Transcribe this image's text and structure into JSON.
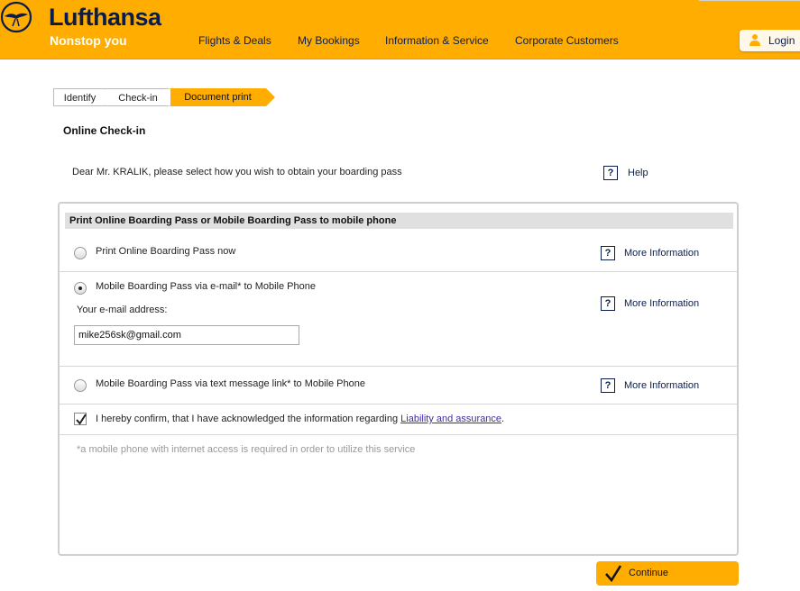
{
  "header": {
    "brand": "Lufthansa",
    "tagline": "Nonstop you",
    "nav": [
      "Flights & Deals",
      "My Bookings",
      "Information & Service",
      "Corporate Customers"
    ],
    "login_label": "Login",
    "login_icon": "user-icon",
    "logo_icon": "crane-logo-icon"
  },
  "breadcrumb": {
    "steps": [
      "Identify",
      "Check-in",
      "Document print"
    ],
    "active_index": 2
  },
  "page": {
    "title": "Online Check-in",
    "greeting": "Dear Mr. KRALIK, please select how you wish to obtain your boarding pass",
    "help_symbol": "?",
    "help_label": "Help"
  },
  "panel": {
    "header": "Print Online Boarding Pass or Mobile Boarding Pass to mobile phone",
    "options": [
      {
        "label": "Print Online Boarding Pass now",
        "selected": false,
        "more_label": "More Information"
      },
      {
        "label": "Mobile Boarding Pass via e-mail* to Mobile Phone",
        "selected": true,
        "more_label": "More Information"
      },
      {
        "label": "Mobile Boarding Pass via text message link* to Mobile Phone",
        "selected": false,
        "more_label": "More Information"
      }
    ],
    "email_label": "Your e-mail address:",
    "email_value": "mike256sk@gmail.com",
    "confirm_prefix": "I hereby confirm, that I have acknowledged the information regarding ",
    "confirm_link": "Liability and assurance",
    "confirm_suffix": ".",
    "confirm_checked": true,
    "footnote": "*a mobile phone with internet access is required in order to utilize this service"
  },
  "continue": {
    "label": "Continue",
    "icon": "checkmark-icon"
  },
  "colors": {
    "brand_yellow": "#ffad00",
    "brand_navy": "#0a1d4a",
    "link_purple": "#3c2fa0"
  }
}
